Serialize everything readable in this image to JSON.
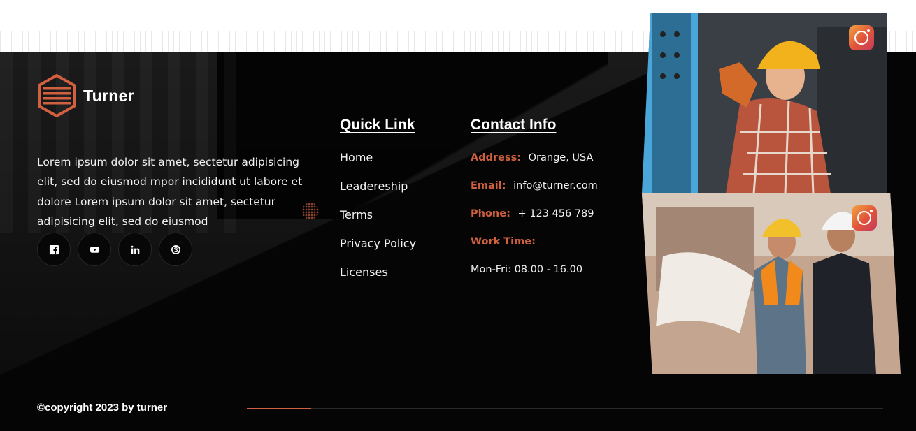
{
  "brand": {
    "name": "Turner",
    "accent_color": "#d0603f"
  },
  "about_text": "Lorem ipsum dolor sit amet, sectetur adipisicing elit, sed do eiusmod mpor incididunt ut labore et dolore Lorem ipsum dolor sit amet, sectetur adipisicing elit, sed do eiusmod",
  "socials": [
    {
      "icon": "facebook-icon"
    },
    {
      "icon": "youtube-icon"
    },
    {
      "icon": "linkedin-icon"
    },
    {
      "icon": "skype-icon"
    }
  ],
  "quick_links": {
    "title": "Quick Link",
    "items": [
      "Home",
      "Leadereship",
      "Terms",
      "Privacy Policy",
      "Licenses"
    ]
  },
  "contact": {
    "title": "Contact Info",
    "address_label": "Address:",
    "address_value": "Orange, USA",
    "email_label": "Email:",
    "email_value": "info@turner.com",
    "phone_label": "Phone:",
    "phone_value": "+ 123 456 789",
    "work_time_label": "Work Time:",
    "work_time_value": "Mon-Fri: 08.00 - 16.00"
  },
  "gallery": [
    {
      "icon": "instagram-icon"
    },
    {
      "icon": "instagram-icon"
    }
  ],
  "copyright": "©copyright 2023 by turner"
}
